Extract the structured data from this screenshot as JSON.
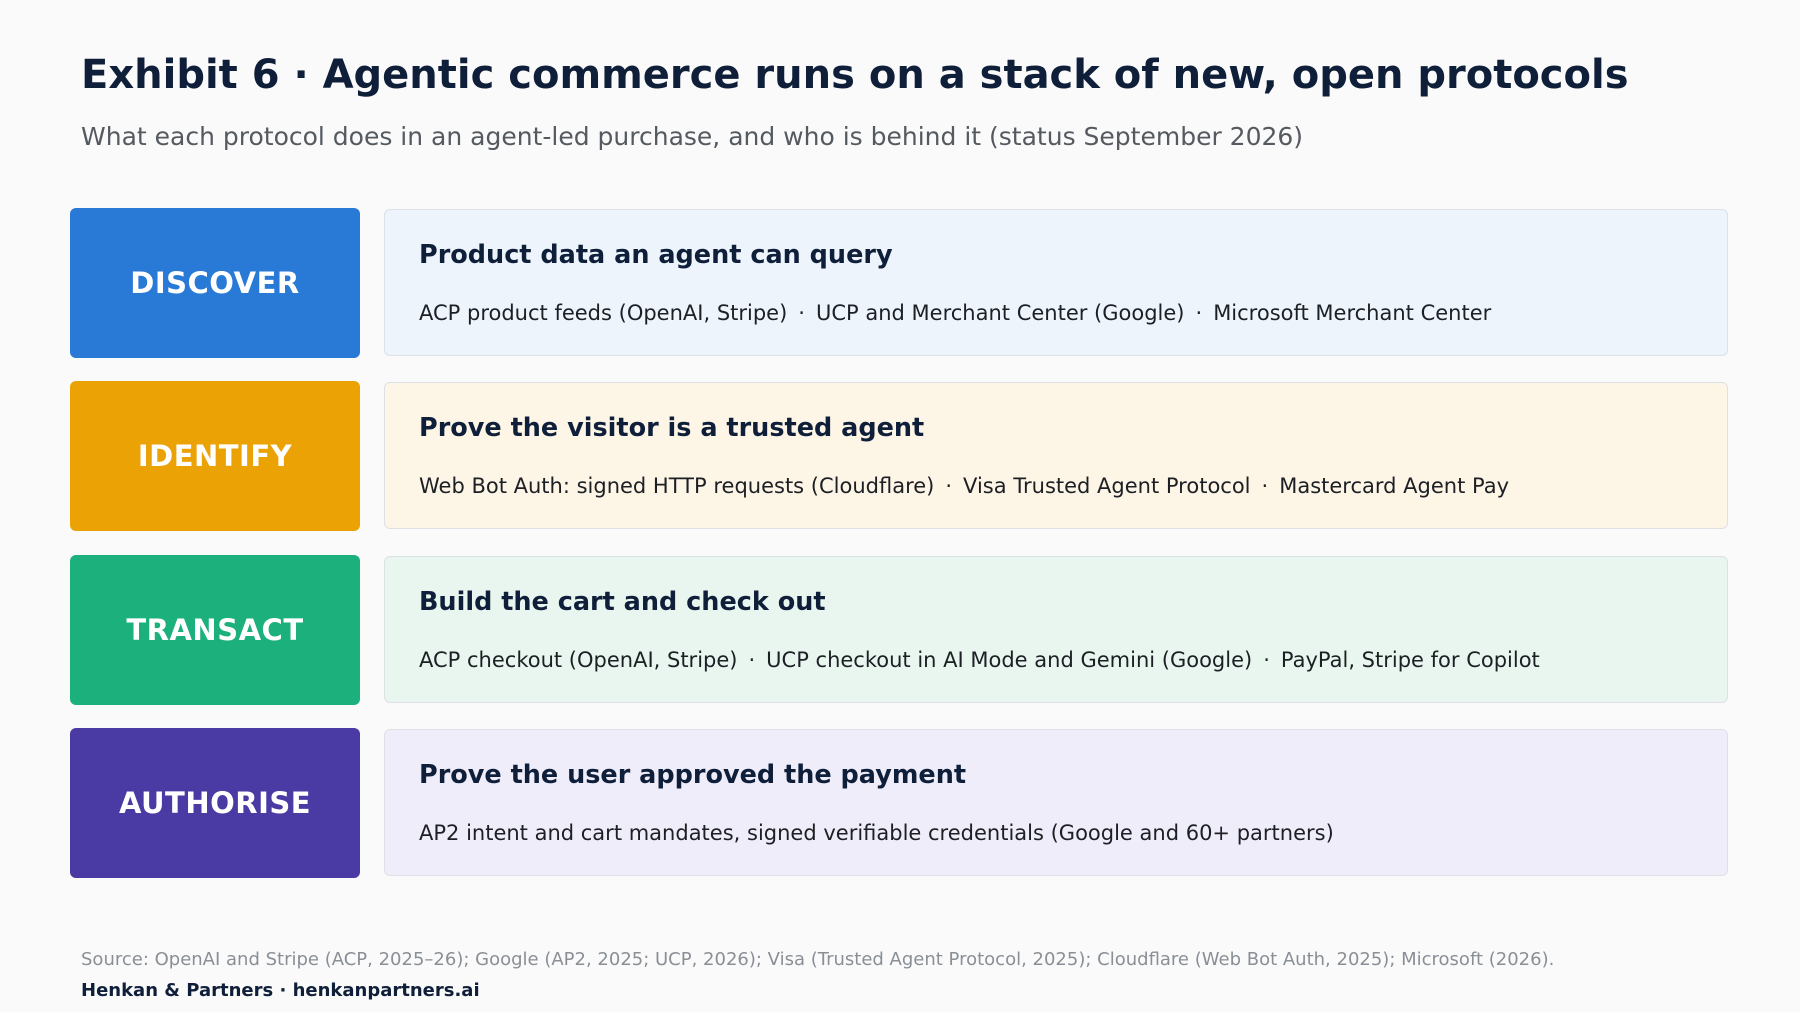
{
  "header": {
    "title": "Exhibit 6 · Agentic commerce runs on a stack of new, open protocols",
    "subtitle": "What each protocol does in an agent-led purchase, and who is behind it (status September 2026)"
  },
  "rows": [
    {
      "stage": "DISCOVER",
      "stage_color": "#2979d6",
      "card_bg": "#edf4fc",
      "heading": "Product data an agent can query",
      "items": [
        "ACP product feeds (OpenAI, Stripe)",
        "UCP and Merchant Center (Google)",
        "Microsoft Merchant Center"
      ]
    },
    {
      "stage": "IDENTIFY",
      "stage_color": "#eba205",
      "card_bg": "#fdf5e6",
      "heading": "Prove the visitor is a trusted agent",
      "items": [
        "Web Bot Auth: signed HTTP requests (Cloudflare)",
        "Visa Trusted Agent Protocol",
        "Mastercard Agent Pay"
      ]
    },
    {
      "stage": "TRANSACT",
      "stage_color": "#1cb07c",
      "card_bg": "#e8f6ef",
      "heading": "Build the cart and check out",
      "items": [
        "ACP checkout (OpenAI, Stripe)",
        "UCP checkout in AI Mode and Gemini (Google)",
        "PayPal, Stripe for Copilot"
      ]
    },
    {
      "stage": "AUTHORISE",
      "stage_color": "#4a3aa3",
      "card_bg": "#efedf9",
      "heading": "Prove the user approved the payment",
      "items": [
        "AP2 intent and cart mandates, signed verifiable credentials (Google and 60+ partners)"
      ]
    }
  ],
  "item_separator": "·",
  "footer": {
    "source": "Source: OpenAI and Stripe (ACP, 2025–26); Google (AP2, 2025; UCP, 2026); Visa (Trusted Agent Protocol, 2025); Cloudflare (Web Bot Auth, 2025); Microsoft (2026).",
    "brand": "Henkan & Partners · henkanpartners.ai"
  }
}
